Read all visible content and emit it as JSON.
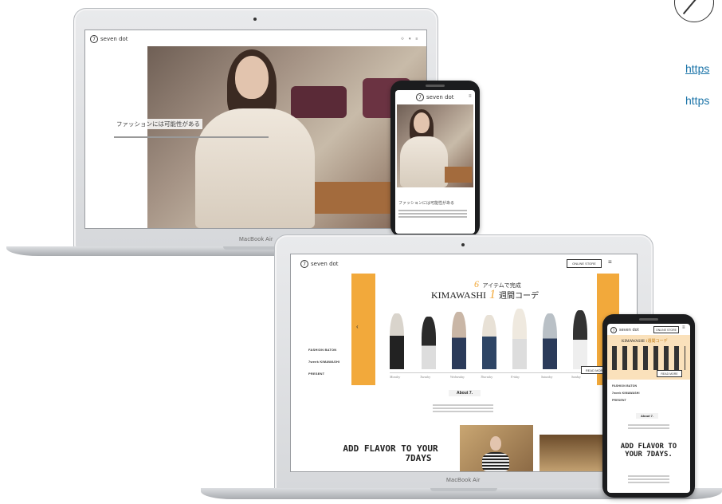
{
  "top_right": {
    "link_line_1": "https",
    "link_line_2": "https"
  },
  "laptop": {
    "brand_label": "MacBook Air"
  },
  "laptop_site": {
    "logo": "seven dot",
    "tagline": "ファッションには可能性がある"
  },
  "phone_site": {
    "logo": "seven dot",
    "tagline": "ファッションには可能性がある"
  },
  "laptop2_site": {
    "logo": "seven dot",
    "online_store": "ONLINE STORE",
    "headline_count": "6",
    "headline_jp": "アイテムで完成",
    "headline_en": "KIMAWASHI",
    "headline_num": "1",
    "headline_week": "週間コーデ",
    "nav": [
      "FASHION BATON",
      "7week KIMAWASHI",
      "PRESENT"
    ],
    "days": [
      "Monday",
      "Tuesday",
      "Wednesday",
      "Thursday",
      "Friday",
      "Saturday",
      "Sunday"
    ],
    "read_more": "READ MORE",
    "about": "About 7.",
    "flavor_line_1": "ADD FLAVOR TO YOUR",
    "flavor_line_2": "7DAYS"
  },
  "phone2_site": {
    "logo": "seven dot",
    "online_store": "ONLINE STORE",
    "headline_en": "KIMAWASHI",
    "headline_jp": "1週間コーデ",
    "nav": [
      "FASHION BATON",
      "7week KIMAWASHI",
      "PRESENT"
    ],
    "read_more": "READ MORE",
    "about": "About 7.",
    "flavor_line_1": "ADD FLAVOR TO",
    "flavor_line_2": "YOUR 7DAYS."
  },
  "colors": {
    "accent_orange": "#f2a93b",
    "link_teal": "#1a73a8"
  }
}
